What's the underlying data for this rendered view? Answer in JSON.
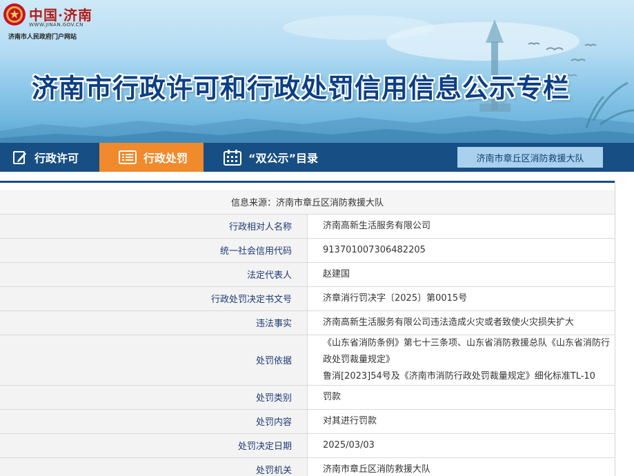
{
  "header": {
    "logo_main": "中国·济南",
    "logo_url": "WWW.JINAN.GOV.CN",
    "logo_sub": "济南市人民政府门户网站",
    "title": "济南市行政许可和行政处罚信用信息公示专栏"
  },
  "nav": {
    "items": [
      {
        "label": "行政许可",
        "icon": "edit-icon"
      },
      {
        "label": "行政处罚",
        "icon": "list-icon",
        "active": true
      },
      {
        "label": "“双公示”目录",
        "icon": "calendar-icon"
      }
    ],
    "department": "济南市章丘区消防救援大队"
  },
  "record": {
    "source": "信息来源：济南市章丘区消防救援大队",
    "rows": [
      {
        "label": "行政相对人名称",
        "value": "济南高新生活服务有限公司"
      },
      {
        "label": "统一社会信用代码",
        "value": "91370100730648220​5"
      },
      {
        "label": "法定代表人",
        "value": "赵建国"
      },
      {
        "label": "行政处罚决定书文号",
        "value": "济章消行罚决字〔2025〕第0015号"
      },
      {
        "label": "违法事实",
        "value": "济南高新生活服务有限公司违法造成火灾或者致使火灾损失扩大"
      },
      {
        "label": "处罚依据",
        "value_line1": "《山东省消防条例》第七十三条项、山东省消防救援总队《山东省消防行政处罚裁量规定》",
        "value_line2": "鲁消[2023]54号及《济南市消防行政处罚裁量规定》细化标准TL-10"
      },
      {
        "label": "处罚类别",
        "value": "罚款"
      },
      {
        "label": "处罚内容",
        "value": "对其进行罚款"
      },
      {
        "label": "处罚决定日期",
        "value": "2025/03/03"
      },
      {
        "label": "处罚机关",
        "value": "济南市章丘区消防救援大队"
      }
    ]
  },
  "colors": {
    "nav_bg": "#174e84",
    "nav_active": "#f08a2c",
    "title_blue": "#0b3f86",
    "label_text": "#1e3a78"
  }
}
